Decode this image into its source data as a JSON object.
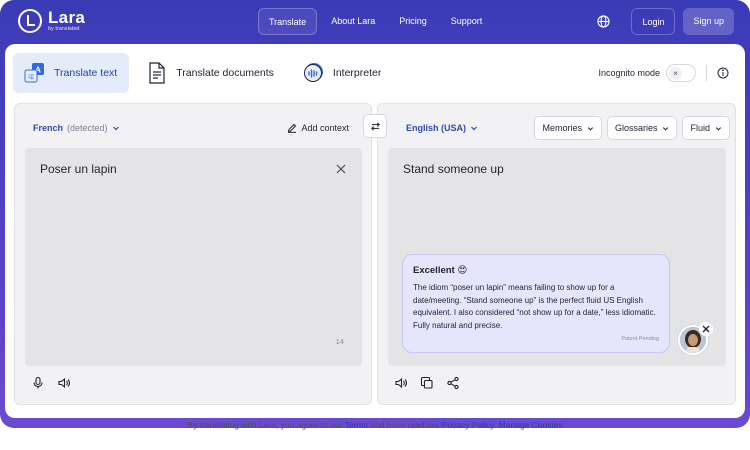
{
  "brand": {
    "name": "Lara",
    "sub": "by translated"
  },
  "nav": {
    "links": [
      "Translate",
      "About Lara",
      "Pricing",
      "Support"
    ],
    "login": "Login",
    "signup": "Sign up"
  },
  "tabs": [
    {
      "label": "Translate text"
    },
    {
      "label": "Translate documents"
    },
    {
      "label": "Interpreter"
    }
  ],
  "incognito": {
    "label": "Incognito mode",
    "state": "off"
  },
  "source": {
    "language": "French",
    "detected": "(detected)",
    "add_context": "Add context",
    "text": "Poser un lapin",
    "char_count": "14"
  },
  "target": {
    "language": "English (USA)",
    "options": [
      "Memories",
      "Glossaries",
      "Fluid"
    ],
    "text": "Stand someone up"
  },
  "feedback": {
    "title": "Excellent 😍",
    "body": "The idiom “poser un lapin” means failing to show up for a date/meeting. “Stand someone up” is the perfect fluid US English equivalent. I also considered “not show up for a date,” less idiomatic. Fully natural and precise.",
    "foot": "Patent Pending"
  },
  "legal": {
    "prefix": "By translating with Lara, you agree to our",
    "terms": "Terms",
    "middle": "and have read our",
    "privacy": "Privacy Policy",
    "sep": ".",
    "cookies": "Manage Cookies"
  },
  "colors": {
    "accent": "#2f4ab3",
    "frame": "#4a3fc1",
    "bubble": "#e7e5fb"
  }
}
